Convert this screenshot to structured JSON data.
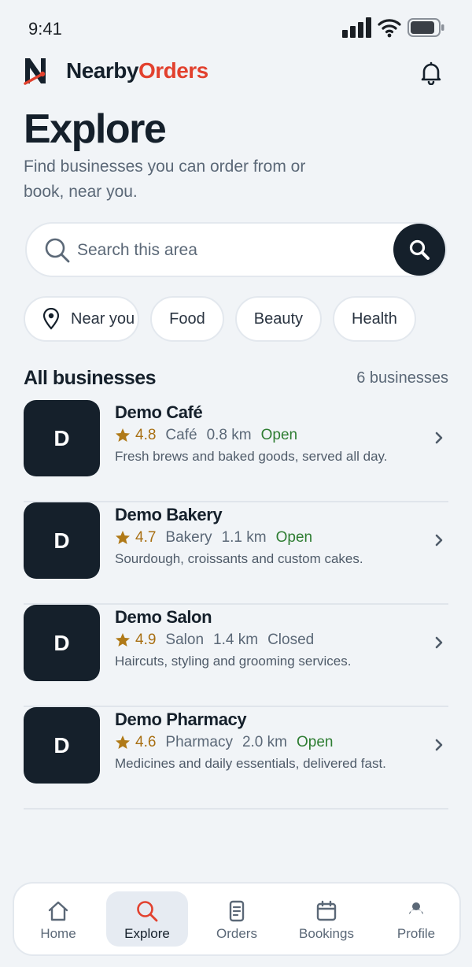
{
  "status_bar": {
    "time": "9:41"
  },
  "brand": {
    "name_part1": "Nearby",
    "name_part2": "Orders",
    "primary_color": "#15202b",
    "accent_color": "#e2412e"
  },
  "page": {
    "title": "Explore",
    "subtitle": "Find businesses you can order from or book, near you."
  },
  "search": {
    "placeholder": "Search this area",
    "value": ""
  },
  "filters": [
    {
      "label": "Near you",
      "icon": "location-pin-icon"
    },
    {
      "label": "Food"
    },
    {
      "label": "Beauty"
    },
    {
      "label": "Health"
    }
  ],
  "section": {
    "title": "All businesses",
    "count_label": "6 businesses"
  },
  "businesses": [
    {
      "initial": "D",
      "name": "Demo Café",
      "rating": "4.8",
      "category": "Café",
      "distance": "0.8 km",
      "status": "Open",
      "description": "Fresh brews and baked goods, served all day."
    },
    {
      "initial": "D",
      "name": "Demo Bakery",
      "rating": "4.7",
      "category": "Bakery",
      "distance": "1.1 km",
      "status": "Open",
      "description": "Sourdough, croissants and custom cakes."
    },
    {
      "initial": "D",
      "name": "Demo Salon",
      "rating": "4.9",
      "category": "Salon",
      "distance": "1.4 km",
      "status": "Closed",
      "description": "Haircuts, styling and grooming services."
    },
    {
      "initial": "D",
      "name": "Demo Pharmacy",
      "rating": "4.6",
      "category": "Pharmacy",
      "distance": "2.0 km",
      "status": "Open",
      "description": "Medicines and daily essentials, delivered fast."
    }
  ],
  "nav": {
    "active": "Explore",
    "items": [
      {
        "label": "Home",
        "icon": "home-icon"
      },
      {
        "label": "Explore",
        "icon": "search-icon"
      },
      {
        "label": "Orders",
        "icon": "receipt-icon"
      },
      {
        "label": "Bookings",
        "icon": "calendar-icon"
      },
      {
        "label": "Profile",
        "icon": "profile-icon"
      }
    ]
  },
  "colors": {
    "background": "#f1f4f7",
    "open": "#2e7d32",
    "rating": "#a86f12",
    "star": "#b07a18"
  }
}
